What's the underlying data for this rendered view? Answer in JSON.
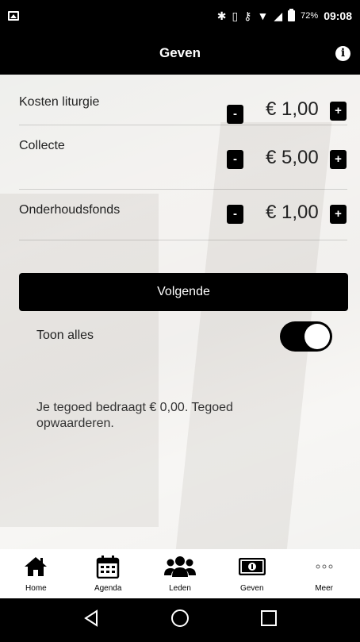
{
  "status_bar": {
    "battery_percent": "72%",
    "time": "09:08"
  },
  "header": {
    "title": "Geven"
  },
  "donations": [
    {
      "label": "Kosten liturgie",
      "amount": "€ 1,00",
      "minus": "-",
      "plus": "+"
    },
    {
      "label": "Collecte",
      "amount": "€ 5,00",
      "minus": "-",
      "plus": "+"
    },
    {
      "label": "Onderhoudsfonds",
      "amount": "€ 1,00",
      "minus": "-",
      "plus": "+"
    }
  ],
  "next_button": "Volgende",
  "show_all": {
    "label": "Toon alles",
    "enabled": true
  },
  "credit_text": "Je tegoed bedraagt € 0,00. Tegoed opwaarderen.",
  "bottom_nav": [
    {
      "label": "Home",
      "icon": "home-icon"
    },
    {
      "label": "Agenda",
      "icon": "calendar-icon"
    },
    {
      "label": "Leden",
      "icon": "people-icon"
    },
    {
      "label": "Geven",
      "icon": "money-icon"
    },
    {
      "label": "Meer",
      "icon": "more-icon"
    }
  ]
}
